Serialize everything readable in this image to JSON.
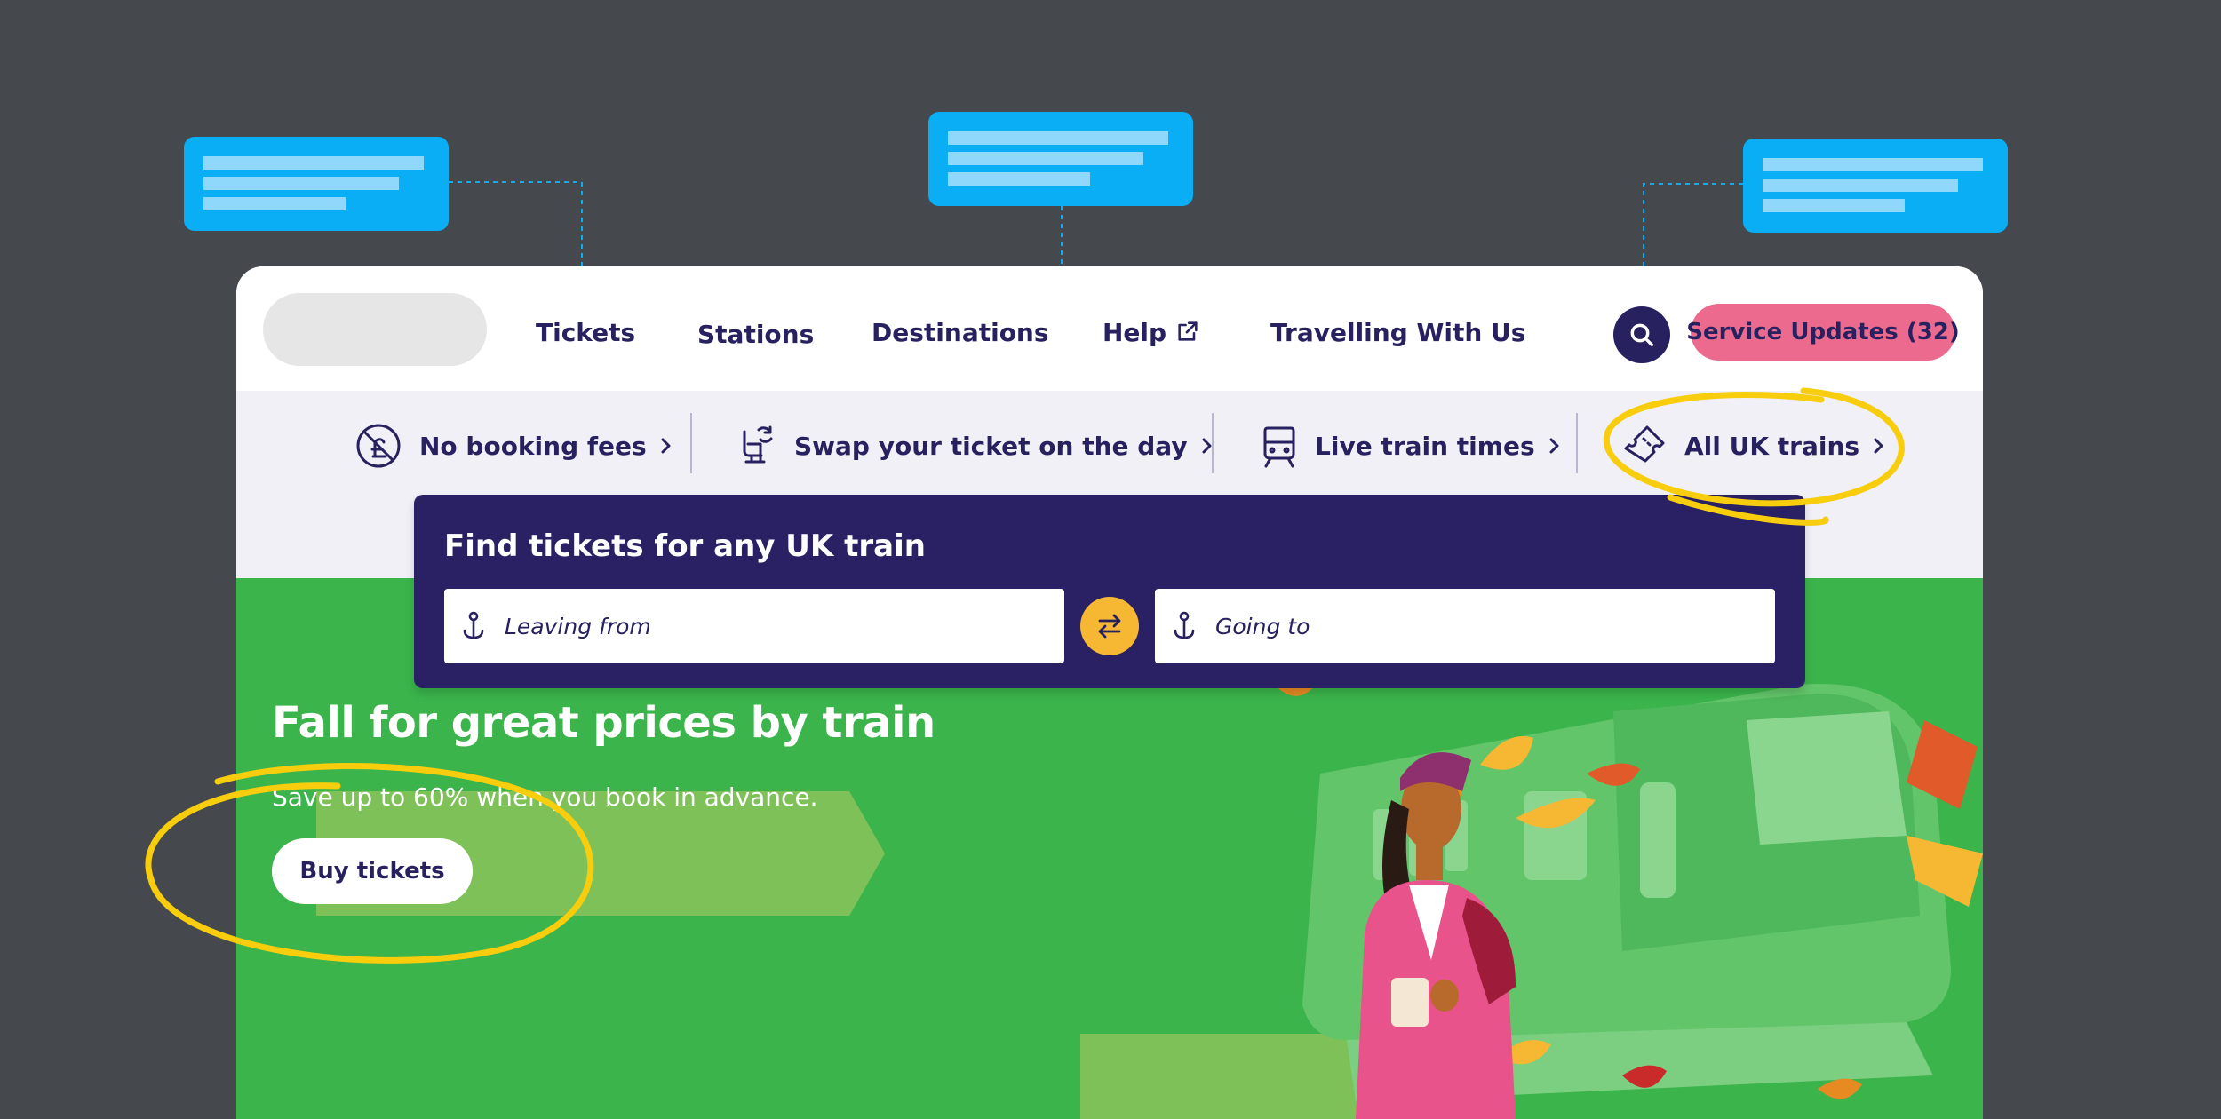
{
  "nav": {
    "links": [
      "Tickets",
      "Stations",
      "Destinations",
      "Help",
      "Travelling With Us"
    ],
    "search_icon": "search-icon",
    "external_icon": "external-link-icon",
    "service_updates_label": "Service Updates (32)"
  },
  "benefits": [
    {
      "label": "No booking fees",
      "icon": "no-fees-icon"
    },
    {
      "label": "Swap your ticket on the day",
      "icon": "seat-swap-icon"
    },
    {
      "label": "Live train times",
      "icon": "train-icon"
    },
    {
      "label": "All UK trains",
      "icon": "ticket-icon"
    }
  ],
  "search": {
    "title": "Find tickets for any UK train",
    "leaving_placeholder": "Leaving from",
    "going_placeholder": "Going to",
    "swap_icon": "swap-icon"
  },
  "hero": {
    "title": "Fall for great prices by train",
    "subtitle": "Save up to 60% when you book in advance.",
    "cta_label": "Buy tickets"
  },
  "colors": {
    "background": "#45494d",
    "navy": "#27215f",
    "hero_green": "#3bb44b",
    "updates_pink": "#ec6a8e",
    "swap_yellow": "#f6b833",
    "callout_blue": "#0aaef5",
    "highlight_yellow": "#f7cd0e"
  }
}
